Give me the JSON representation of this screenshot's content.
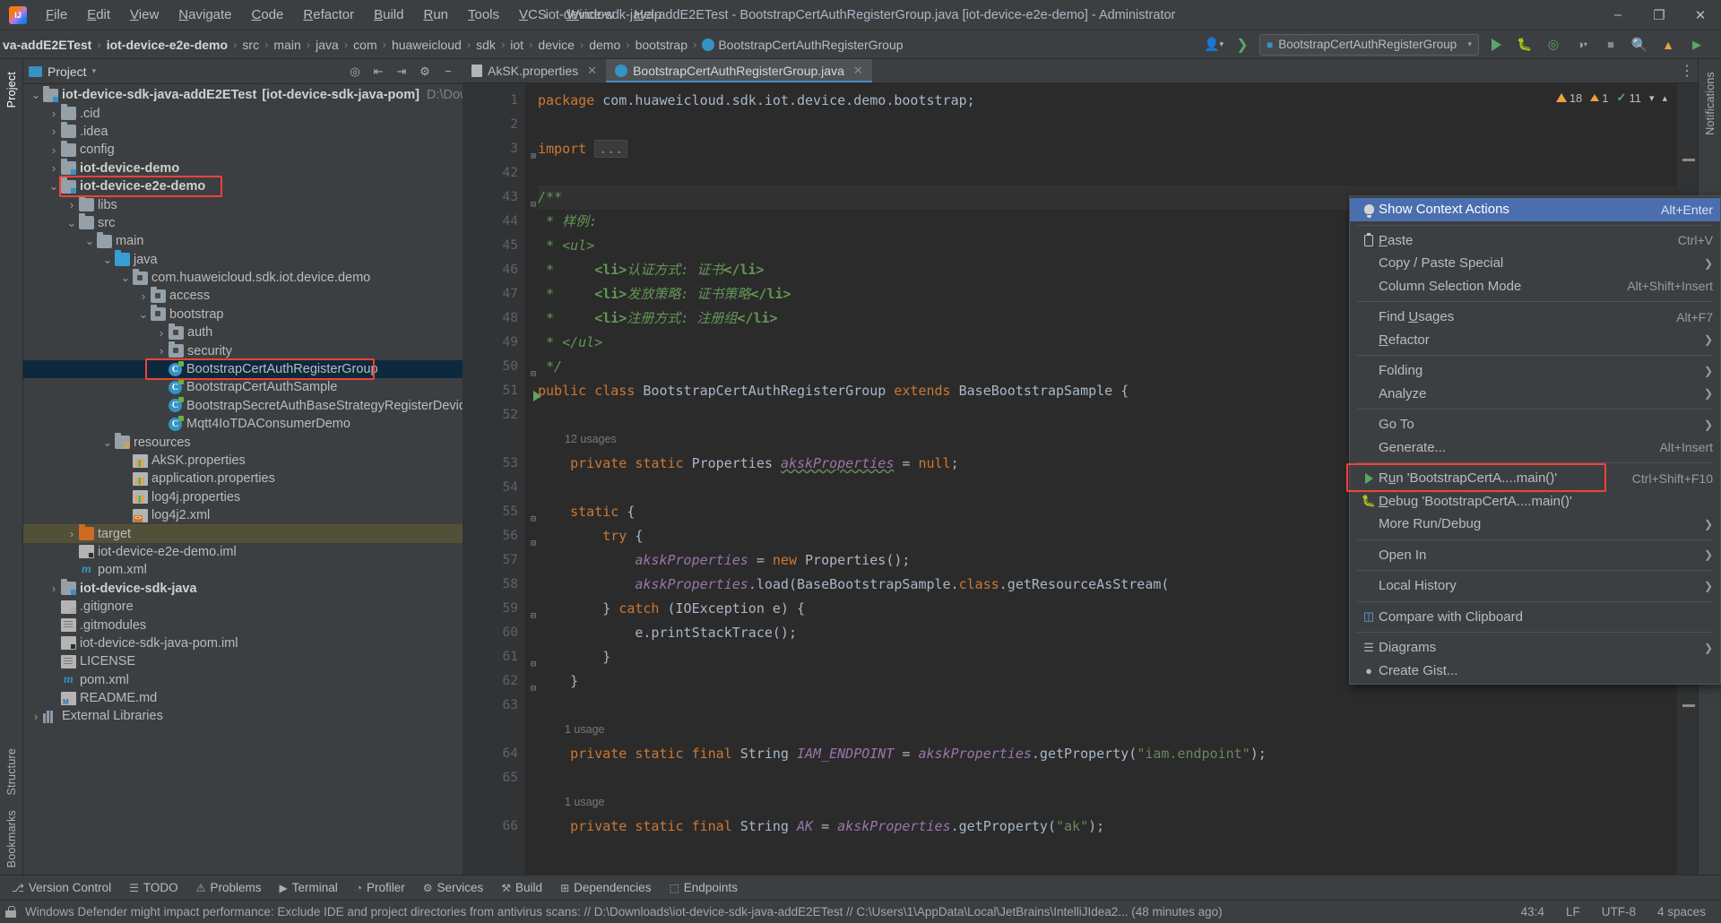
{
  "window": {
    "title": "iot-device-sdk-java-addE2ETest - BootstrapCertAuthRegisterGroup.java [iot-device-e2e-demo] - Administrator",
    "minimize": "–",
    "maximize": "❐",
    "close": "✕"
  },
  "menubar": [
    {
      "label": "File"
    },
    {
      "label": "Edit"
    },
    {
      "label": "View"
    },
    {
      "label": "Navigate"
    },
    {
      "label": "Code"
    },
    {
      "label": "Refactor"
    },
    {
      "label": "Build"
    },
    {
      "label": "Run"
    },
    {
      "label": "Tools"
    },
    {
      "label": "VCS"
    },
    {
      "label": "Window"
    },
    {
      "label": "Help"
    }
  ],
  "breadcrumbs": [
    {
      "label": "va-addE2ETest",
      "bold": true
    },
    {
      "label": "iot-device-e2e-demo",
      "bold": true
    },
    {
      "label": "src"
    },
    {
      "label": "main"
    },
    {
      "label": "java"
    },
    {
      "label": "com"
    },
    {
      "label": "huaweicloud"
    },
    {
      "label": "sdk"
    },
    {
      "label": "iot"
    },
    {
      "label": "device"
    },
    {
      "label": "demo"
    },
    {
      "label": "bootstrap"
    },
    {
      "label": "BootstrapCertAuthRegisterGroup",
      "icon": "java-class-icon"
    }
  ],
  "toolbar": {
    "run_config": "BootstrapCertAuthRegisterGroup",
    "run_title": "Run",
    "debug_title": "Debug",
    "coverage_title": "Run with Coverage",
    "profile_title": "Profile",
    "stop_title": "Stop",
    "search_title": "Search Everywhere",
    "updates_title": "Updates",
    "icons": [
      "run-icon",
      "debug-icon",
      "coverage-icon",
      "profile-icon",
      "stop-icon",
      "search-icon",
      "notification-icon",
      "share-icon"
    ]
  },
  "left_strip": [
    {
      "label": "Project",
      "selected": true
    },
    {
      "label": "Structure",
      "selected": false
    },
    {
      "label": "Bookmarks",
      "selected": false
    }
  ],
  "right_strip": [
    {
      "label": "Notifications"
    }
  ],
  "project_panel": {
    "title": "Project",
    "header_icons": [
      "target-icon",
      "collapse-all-icon",
      "expand-all-icon",
      "settings-icon",
      "hide-icon"
    ],
    "tree": [
      {
        "depth": 0,
        "twisty": "⌄",
        "icon": "folder-module",
        "label": "iot-device-sdk-java-addE2ETest",
        "bold": true,
        "suffix": "[iot-device-sdk-java-pom]",
        "path": "D:\\Downloads\\"
      },
      {
        "depth": 1,
        "twisty": "›",
        "icon": "folder",
        "label": ".cid"
      },
      {
        "depth": 1,
        "twisty": "›",
        "icon": "folder",
        "label": ".idea"
      },
      {
        "depth": 1,
        "twisty": "›",
        "icon": "folder",
        "label": "config"
      },
      {
        "depth": 1,
        "twisty": "›",
        "icon": "folder-module",
        "label": "iot-device-demo",
        "bold": true
      },
      {
        "depth": 1,
        "twisty": "⌄",
        "icon": "folder-module",
        "label": "iot-device-e2e-demo",
        "bold": true,
        "highlight": true
      },
      {
        "depth": 2,
        "twisty": "›",
        "icon": "folder",
        "label": "libs"
      },
      {
        "depth": 2,
        "twisty": "⌄",
        "icon": "folder",
        "label": "src"
      },
      {
        "depth": 3,
        "twisty": "⌄",
        "icon": "folder",
        "label": "main"
      },
      {
        "depth": 4,
        "twisty": "⌄",
        "icon": "folder-source",
        "label": "java"
      },
      {
        "depth": 5,
        "twisty": "⌄",
        "icon": "package",
        "label": "com.huaweicloud.sdk.iot.device.demo"
      },
      {
        "depth": 6,
        "twisty": "›",
        "icon": "package",
        "label": "access"
      },
      {
        "depth": 6,
        "twisty": "⌄",
        "icon": "package",
        "label": "bootstrap"
      },
      {
        "depth": 7,
        "twisty": "›",
        "icon": "package",
        "label": "auth"
      },
      {
        "depth": 7,
        "twisty": "›",
        "icon": "package",
        "label": "security"
      },
      {
        "depth": 7,
        "twisty": "",
        "icon": "java-class",
        "label": "BootstrapCertAuthRegisterGroup",
        "selected": true,
        "highlight": true
      },
      {
        "depth": 7,
        "twisty": "",
        "icon": "java-class",
        "label": "BootstrapCertAuthSample"
      },
      {
        "depth": 7,
        "twisty": "",
        "icon": "java-class",
        "label": "BootstrapSecretAuthBaseStrategyRegisterDevice"
      },
      {
        "depth": 7,
        "twisty": "",
        "icon": "java-class",
        "label": "Mqtt4IoTDAConsumerDemo"
      },
      {
        "depth": 4,
        "twisty": "⌄",
        "icon": "folder-resources",
        "label": "resources"
      },
      {
        "depth": 5,
        "twisty": "",
        "icon": "properties",
        "label": "AkSK.properties"
      },
      {
        "depth": 5,
        "twisty": "",
        "icon": "properties",
        "label": "application.properties"
      },
      {
        "depth": 5,
        "twisty": "",
        "icon": "properties",
        "label": "log4j.properties"
      },
      {
        "depth": 5,
        "twisty": "",
        "icon": "xml",
        "label": "log4j2.xml"
      },
      {
        "depth": 2,
        "twisty": "›",
        "icon": "folder-target",
        "label": "target",
        "olive": true
      },
      {
        "depth": 2,
        "twisty": "",
        "icon": "iml",
        "label": "iot-device-e2e-demo.iml"
      },
      {
        "depth": 2,
        "twisty": "",
        "icon": "maven",
        "label": "pom.xml"
      },
      {
        "depth": 1,
        "twisty": "›",
        "icon": "folder-module",
        "label": "iot-device-sdk-java",
        "bold": true
      },
      {
        "depth": 1,
        "twisty": "",
        "icon": "gitignore",
        "label": ".gitignore"
      },
      {
        "depth": 1,
        "twisty": "",
        "icon": "text",
        "label": ".gitmodules"
      },
      {
        "depth": 1,
        "twisty": "",
        "icon": "iml",
        "label": "iot-device-sdk-java-pom.iml"
      },
      {
        "depth": 1,
        "twisty": "",
        "icon": "text",
        "label": "LICENSE"
      },
      {
        "depth": 1,
        "twisty": "",
        "icon": "maven",
        "label": "pom.xml"
      },
      {
        "depth": 1,
        "twisty": "",
        "icon": "markdown",
        "label": "README.md"
      },
      {
        "depth": 0,
        "twisty": "›",
        "icon": "libraries",
        "label": "External Libraries"
      }
    ]
  },
  "editor": {
    "tabs": [
      {
        "label": "AkSK.properties",
        "icon": "properties-icon",
        "active": false,
        "close": "✕"
      },
      {
        "label": "BootstrapCertAuthRegisterGroup.java",
        "icon": "java-class-icon",
        "active": true,
        "close": "✕"
      }
    ],
    "inspections": {
      "warnings": "18",
      "weak_warnings": "1",
      "typos": "11",
      "collapse": "⌄",
      "expand": "⌃"
    },
    "lines": [
      {
        "num": "1",
        "type": "code",
        "html": "<span class=\"kw\">package</span> com.huaweicloud.sdk.iot.device.demo.bootstrap;"
      },
      {
        "num": "2",
        "type": "code",
        "html": ""
      },
      {
        "num": "3",
        "type": "code",
        "fold": "⊞",
        "html": "<span class=\"kw\">import</span> <span class=\"foldbox\">...</span>"
      },
      {
        "num": "42",
        "type": "code",
        "html": ""
      },
      {
        "num": "43",
        "type": "code",
        "fold": "⊟",
        "hl": true,
        "html": "<span class=\"cmt\">/**</span>"
      },
      {
        "num": "44",
        "type": "code",
        "html": " <span class=\"cmt\">* 样例:</span>"
      },
      {
        "num": "45",
        "type": "code",
        "html": " <span class=\"cmt\">* &lt;ul&gt;</span>"
      },
      {
        "num": "46",
        "type": "code",
        "html": " <span class=\"cmt\">*     <b>&lt;li&gt;</b>认证方式: 证书<b>&lt;/li&gt;</b></span>"
      },
      {
        "num": "47",
        "type": "code",
        "html": " <span class=\"cmt\">*     <b>&lt;li&gt;</b>发放策略: 证书策略<b>&lt;/li&gt;</b></span>"
      },
      {
        "num": "48",
        "type": "code",
        "html": " <span class=\"cmt\">*     <b>&lt;li&gt;</b>注册方式: 注册组<b>&lt;/li&gt;</b></span>"
      },
      {
        "num": "49",
        "type": "code",
        "html": " <span class=\"cmt\">* &lt;/ul&gt;</span>"
      },
      {
        "num": "50",
        "type": "code",
        "fold": "⊟",
        "html": " <span class=\"cmt\">*/</span>"
      },
      {
        "num": "51",
        "type": "code",
        "run": true,
        "html": "<span class=\"kw\">public class</span> BootstrapCertAuthRegisterGroup <span class=\"kw\">extends</span> BaseBootstrapSample {"
      },
      {
        "num": "52",
        "type": "code",
        "html": ""
      },
      {
        "num": "",
        "type": "usage",
        "text": "12 usages"
      },
      {
        "num": "53",
        "type": "code",
        "html": "    <span class=\"kw\">private static</span> Properties <span class=\"cfld\">akskProperties</span> = <span class=\"kw\">null</span>;"
      },
      {
        "num": "54",
        "type": "code",
        "html": ""
      },
      {
        "num": "55",
        "type": "code",
        "fold": "⊟",
        "html": "    <span class=\"kw\">static</span> {"
      },
      {
        "num": "56",
        "type": "code",
        "fold": "⊟",
        "html": "        <span class=\"kw\">try</span> {"
      },
      {
        "num": "57",
        "type": "code",
        "html": "            <span class=\"fld\">akskProperties</span> = <span class=\"kw\">new</span> Properties();"
      },
      {
        "num": "58",
        "type": "code",
        "html": "            <span class=\"fld\">akskProperties</span>.load(BaseBootstrapSample.<span class=\"kw\">class</span>.getResourceAsStream("
      },
      {
        "num": "59",
        "type": "code",
        "fold": "⊟",
        "html": "        } <span class=\"kw\">catch</span> (IOException e) {"
      },
      {
        "num": "60",
        "type": "code",
        "html": "            e.printStackTrace();"
      },
      {
        "num": "61",
        "type": "code",
        "fold": "⊟",
        "html": "        }"
      },
      {
        "num": "62",
        "type": "code",
        "fold": "⊟",
        "html": "    }"
      },
      {
        "num": "63",
        "type": "code",
        "html": ""
      },
      {
        "num": "",
        "type": "usage",
        "text": "1 usage"
      },
      {
        "num": "64",
        "type": "code",
        "html": "    <span class=\"kw\">private static final</span> String <span class=\"constf\">IAM_ENDPOINT</span> = <span class=\"fld\">akskProperties</span>.getProperty(<span class=\"str\">\"iam.endpoint\"</span>);"
      },
      {
        "num": "65",
        "type": "code",
        "html": ""
      },
      {
        "num": "",
        "type": "usage",
        "text": "1 usage"
      },
      {
        "num": "66",
        "type": "code",
        "html": "    <span class=\"kw\">private static final</span> String <span class=\"constf\">AK</span> = <span class=\"fld\">akskProperties</span>.getProperty(<span class=\"str\">\"ak\"</span>);"
      }
    ]
  },
  "context_menu": [
    {
      "label": "Show Context Actions",
      "key": "Alt+Enter",
      "icon": "lightbulb-icon",
      "selected": true
    },
    {
      "separator": true
    },
    {
      "label": "Paste",
      "underline": "P",
      "key": "Ctrl+V",
      "icon": "clipboard-icon"
    },
    {
      "label": "Copy / Paste Special",
      "key": "",
      "arrow": true
    },
    {
      "label": "Column Selection Mode",
      "key": "Alt+Shift+Insert"
    },
    {
      "separator": true
    },
    {
      "label": "Find Usages",
      "underline": "U",
      "key": "Alt+F7"
    },
    {
      "label": "Refactor",
      "underline": "R",
      "key": "",
      "arrow": true
    },
    {
      "separator": true
    },
    {
      "label": "Folding",
      "key": "",
      "arrow": true
    },
    {
      "label": "Analyze",
      "key": "",
      "arrow": true
    },
    {
      "separator": true
    },
    {
      "label": "Go To",
      "key": "",
      "arrow": true
    },
    {
      "label": "Generate...",
      "key": "Alt+Insert"
    },
    {
      "separator": true
    },
    {
      "label": "Run 'BootstrapCertA....main()'",
      "underline": "u",
      "key": "Ctrl+Shift+F10",
      "icon": "run-icon",
      "highlight": true
    },
    {
      "label": "Debug 'BootstrapCertA....main()'",
      "underline": "D",
      "key": "",
      "icon": "debug-icon"
    },
    {
      "label": "More Run/Debug",
      "key": "",
      "arrow": true
    },
    {
      "separator": true
    },
    {
      "label": "Open In",
      "key": "",
      "arrow": true
    },
    {
      "separator": true
    },
    {
      "label": "Local History",
      "key": "",
      "arrow": true
    },
    {
      "separator": true
    },
    {
      "label": "Compare with Clipboard",
      "key": "",
      "icon": "compare-icon"
    },
    {
      "separator": true
    },
    {
      "label": "Diagrams",
      "key": "",
      "icon": "diagram-icon",
      "arrow": true
    },
    {
      "label": "Create Gist...",
      "key": "",
      "icon": "github-icon"
    }
  ],
  "bottom_bar": [
    {
      "label": "Version Control",
      "icon": "branch-icon"
    },
    {
      "label": "TODO",
      "icon": "todo-icon"
    },
    {
      "label": "Problems",
      "icon": "problems-icon"
    },
    {
      "label": "Terminal",
      "icon": "terminal-icon"
    },
    {
      "label": "Profiler",
      "icon": "profiler-icon"
    },
    {
      "label": "Services",
      "icon": "services-icon"
    },
    {
      "label": "Build",
      "icon": "build-icon"
    },
    {
      "label": "Dependencies",
      "icon": "dependencies-icon"
    },
    {
      "label": "Endpoints",
      "icon": "endpoints-icon"
    }
  ],
  "status_bar": {
    "message": "Windows Defender might impact performance: Exclude IDE and project directories from antivirus scans:  // D:\\Downloads\\iot-device-sdk-java-addE2ETest  // C:\\Users\\1\\AppData\\Local\\JetBrains\\IntelliJIdea2... (48 minutes ago)",
    "caret": "43:4",
    "line_sep": "LF",
    "encoding": "UTF-8",
    "indent": "4 spaces",
    "lock_icon": "lock-icon"
  },
  "colors": {
    "accent": "#4b6eaf",
    "highlight_red": "#f24236",
    "run_green": "#59a869",
    "selection": "#0d293e",
    "olive": "#53503a"
  }
}
